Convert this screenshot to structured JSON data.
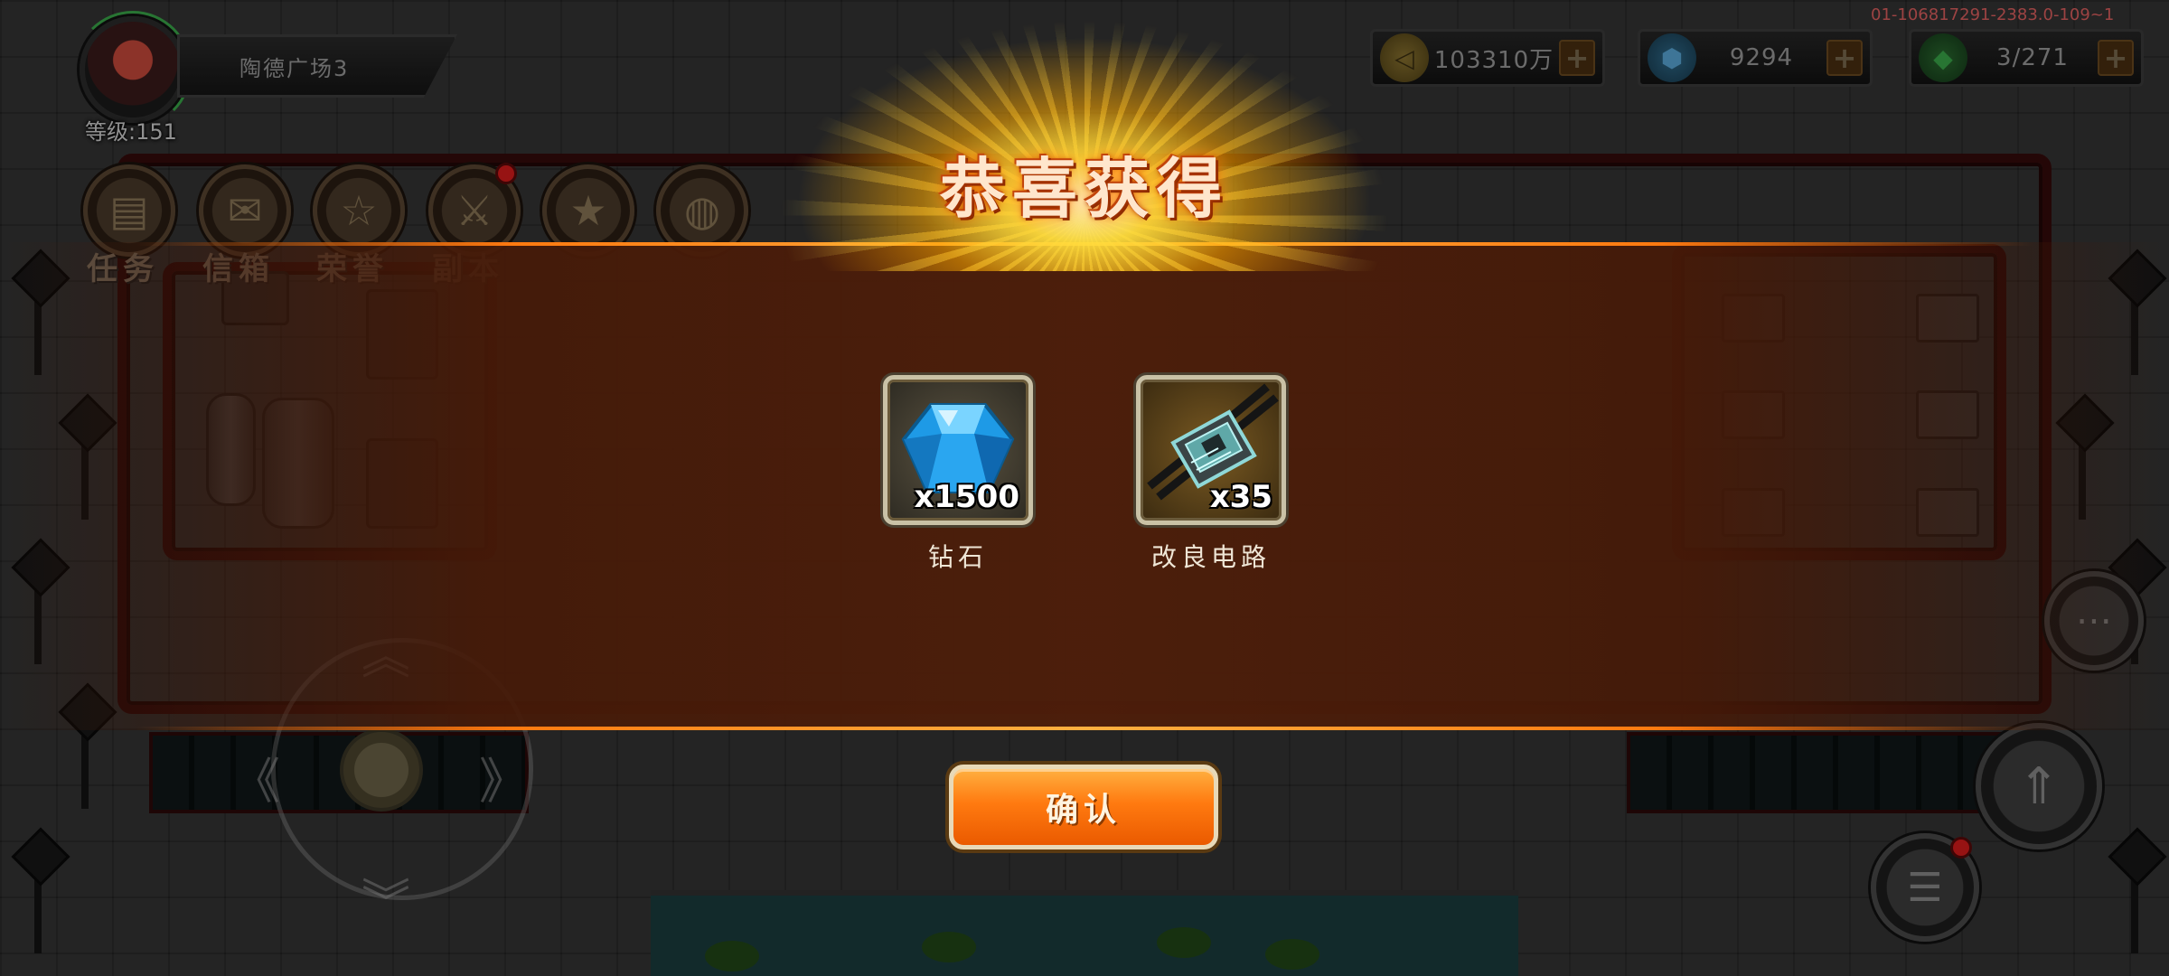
{
  "player": {
    "location": "陶德广场3",
    "level_text": "等级:151"
  },
  "menu": {
    "items": [
      {
        "label": "任务",
        "icon": "scroll-icon"
      },
      {
        "label": "信箱",
        "icon": "mailbox-icon"
      },
      {
        "label": "荣誉",
        "icon": "badge-icon"
      },
      {
        "label": "副本",
        "icon": "dungeon-icon",
        "has_alert": true
      },
      {
        "label": "",
        "icon": "star-icon"
      },
      {
        "label": "",
        "icon": "globe-icon"
      }
    ]
  },
  "resources": {
    "gold": "103310万",
    "diamond": "9294",
    "energy": "3/271"
  },
  "build_id": "01-106817291-2383.0-109~1",
  "reward_popup": {
    "title": "恭喜获得",
    "items": [
      {
        "name": "钻石",
        "quantity": "x1500",
        "icon": "diamond-icon"
      },
      {
        "name": "改良电路",
        "quantity": "x35",
        "icon": "circuit-board-icon"
      }
    ],
    "confirm_label": "确认"
  },
  "colors": {
    "accent_orange": "#ff7a10",
    "title_glow": "#ff6a00",
    "alert_red": "#d91c1c"
  }
}
